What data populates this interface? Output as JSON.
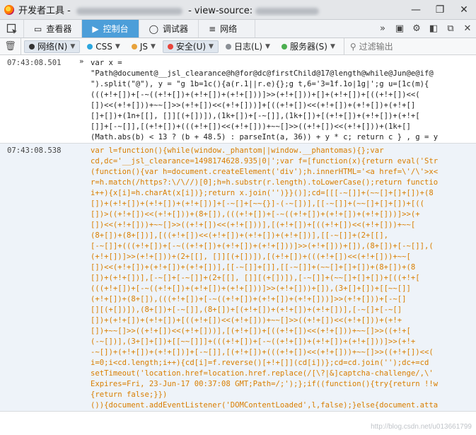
{
  "window": {
    "title_prefix": "开发者工具 - ",
    "title_mid": " - view-source:",
    "controls": [
      "—",
      "❐",
      "✕"
    ]
  },
  "tabs": [
    {
      "icon": "▭",
      "label": "查看器",
      "selected": false
    },
    {
      "icon": "▶",
      "label": "控制台",
      "selected": true
    },
    {
      "icon": "◯",
      "label": "调试器",
      "selected": false
    },
    {
      "icon": "≡",
      "label": "网络",
      "selected": false
    }
  ],
  "filters": [
    {
      "label": "网络(N)",
      "color": "#333333",
      "active": true
    },
    {
      "label": "CSS",
      "color": "#2ba6de",
      "active": false
    },
    {
      "label": "JS",
      "color": "#e8a33c",
      "active": false
    },
    {
      "label": "安全(U)",
      "color": "#e8453c",
      "active": true
    },
    {
      "label": "日志(L)",
      "color": "#8a8f95",
      "active": false
    },
    {
      "label": "服务器(S)",
      "color": "#4caf50",
      "active": false
    }
  ],
  "filter_output_placeholder": "过滤输出",
  "console": {
    "input_entry": {
      "timestamp": "07:43:08.501",
      "prompt": "»",
      "lines": [
        "var x =",
        "\"Path@document@__jsl_clearance@h@for@dc@firstChild@17@length@while@Jun@e@if@",
        "\").split(\"@\"), y = \"g 1b=1c(){a(r.1||r.e){};g t,6='3=1f.1o|1g|';g u=[1c(m){",
        "(((+!+[])+[-~((+!+[])+(+!+[])+(+!+[]))]>>(+!+[]))+[]+(+!+[])+[((+!+[])<<(",
        "[])<<(+!+[]))+~~[]>>(+!+[])<<(+!+[]))]+[((+!+[])<<(+!+[])+(+!+[])+(+!+[]",
        "[]+[])+(1n+[[], []][(+[])]),(1k+[])+[-~[]],(1k+[])+[(+!+[])+(+!+[])+(+!+[",
        "[]]+[-~[]],[(+!+[])+(((+!+[])<<(+!+[]))+~~[]>>((+!+[])<<(+!+[]))+(1k+[]",
        "(Math.abs(b) < 13 ? (b + 48.5) : parseInt(a, 36)) + y * c; return c } , g = y"
      ]
    },
    "output_entry": {
      "timestamp": "07:43:08.538",
      "lines": [
        "var l=function(){while(window._phantom||window.__phantomas){};var",
        "cd,dc='__jsl_clearance=1498174628.935|0|';var f=[function(x){return eval('Str",
        "(function(){var h=document.createElement('div');h.innerHTML='<a href=\\'/\\'>x<",
        "r=h.match(/https?:\\/\\//)[0];h=h.substr(r.length).toLowerCase();return functio",
        "i++){x[i]=h.charAt(x[i])};return x.join('')}}()];cd=[[[-~[]]+(~~[]+[]+[])+(8",
        "[])+(+!+[])+(+!+[])+(+!+[])]+[-~[]+[~~{}]-(-~[])],[[-~[]]+(~~[]+[]+[])+[((",
        "[])>((+!+[])<<(+!+[]))+(8+[]),(((+!+[])+[-~((+!+[])+(+!+[])+(+!+[]))]>>(+",
        "[])<<(+!+[]))+~~[]>>((+!+[])<<(+!+[]))],[(+!+[])+[((+!+[])<<(+!+[]))+~~[",
        "(8+[])+(8+[])],[((+!+[])<<(+!+[])+(+!+[])+(+!+[])],[[-~[]]+(2+[[],",
        "[-~[]]+(((+!+[])+[-~((+!+[])+(+!+[])+(+!+[]))]>>(+!+[]))+[]),(8+[])+[-~[]],(",
        "(+!+[])]>>(+!+[]))+(2+[[], []][(+[])]),[(+!+[])+(((+!+[])<<(+!+[]))+~~[",
        "[])<<(+!+[])+(+!+[])+(+!+[])],[[-~[]]+[]],[[-~[]]+(~~[]+[]+[])+(8+[])+(8",
        "[])+(+!+[])],[-~[]+[-~[]]+(2+[[], []][(+[])]),[-~[]]+(~~[]+[]+[])+[((+!+[",
        "(((+!+[])+[-~((+!+[])+(+!+[])+(+!+[]))]>>(+!+[]))+[]),(3+[]+[])+[[~~[]]",
        "(+!+[])+(8+[]),(((+!+[])+[-~((+!+[])+(+!+[])+(+!+[]))]>>(+!+[]))+[-~[]",
        "[][(+[])]),(8+[])+[-~[]],(8+[])+[(+!+[])+(+!+[])+(+!+[])],[-~[]+[-~[]",
        "[])+(+!+[])+(+!+[])+[((+!+[])<<(+!+[]))+~~[]>>((+!+[])<<(+!+[]))+(+!+",
        "[])+~~[]>>((+!+[])<<(+!+[]))],[(+!+[])+[((+!+[])<<(+!+[]))+~~[]>>((+!+[",
        "(-~[])],(3+[]+[])+[[~~[]]]+(((+!+[])+[-~((+!+[])+(+!+[])+(+!+[]))]>>(+!+",
        "-~[])+(+!+[])+(+!+[])]+[-~[]],[(+!+[])+(((+!+[])<<(+!+[]))+~~[]>>((+!+[])<<(",
        "i=0;i<cd.length;i++){cd[i]=f.reverse()[+!+[]](cd[i])};cd=cd.join('');dc+=cd",
        "setTimeout('location.href=location.href.replace(/[\\?|&]captcha-challenge/,\\'",
        "Expires=Fri, 23-Jun-17 00:37:08 GMT;Path=/;');};if((function(){try{return !!w",
        "{return false;}})",
        "()){document.addEventListener('DOMContentLoaded',l,false);}else{document.atta"
      ]
    }
  },
  "watermark": "http://blog.csdn.net/u013661799"
}
